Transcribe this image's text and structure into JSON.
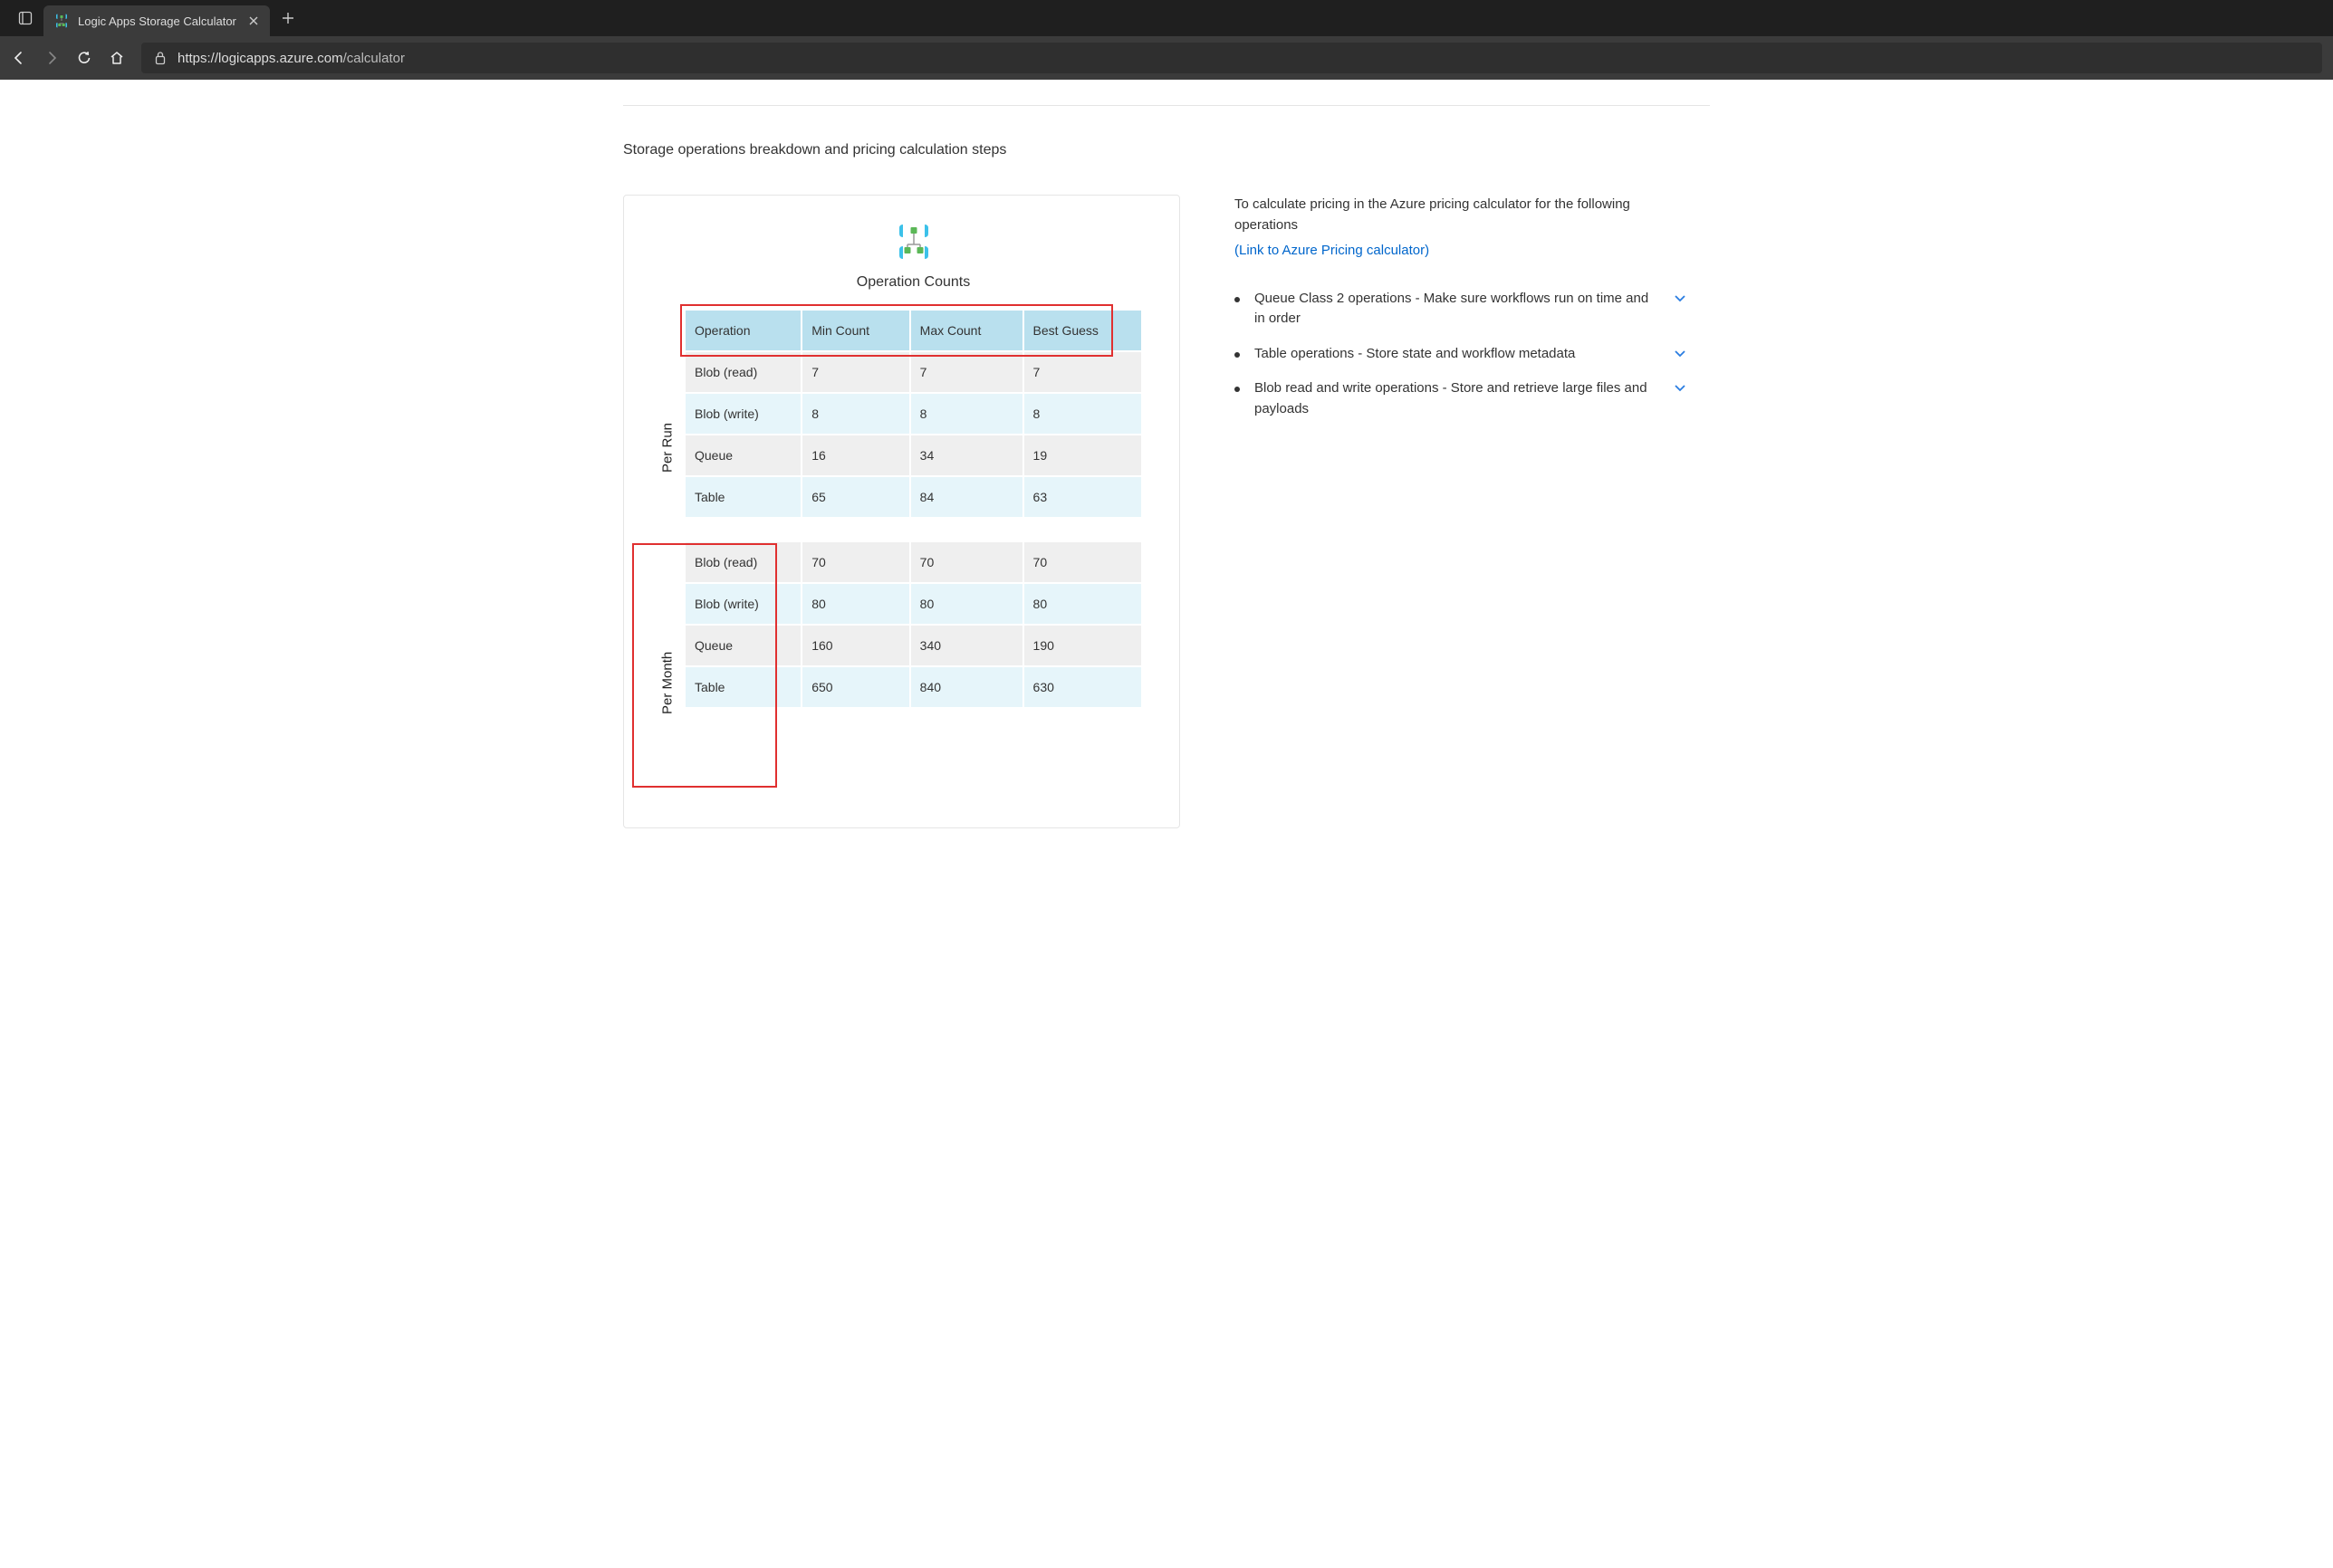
{
  "browser": {
    "tab_title": "Logic Apps Storage Calculator",
    "url_host": "https://logicapps.azure.com",
    "url_path": "/calculator"
  },
  "page": {
    "breakdown_heading": "Storage operations breakdown and pricing calculation steps",
    "panel": {
      "title": "Operation Counts",
      "side_labels": {
        "per_run": "Per Run",
        "per_month": "Per Month"
      },
      "headers": {
        "operation": "Operation",
        "min": "Min Count",
        "max": "Max Count",
        "best": "Best Guess"
      },
      "per_run_rows": [
        {
          "op": "Blob (read)",
          "min": "7",
          "max": "7",
          "best": "7"
        },
        {
          "op": "Blob (write)",
          "min": "8",
          "max": "8",
          "best": "8"
        },
        {
          "op": "Queue",
          "min": "16",
          "max": "34",
          "best": "19"
        },
        {
          "op": "Table",
          "min": "65",
          "max": "84",
          "best": "63"
        }
      ],
      "per_month_rows": [
        {
          "op": "Blob (read)",
          "min": "70",
          "max": "70",
          "best": "70"
        },
        {
          "op": "Blob (write)",
          "min": "80",
          "max": "80",
          "best": "80"
        },
        {
          "op": "Queue",
          "min": "160",
          "max": "340",
          "best": "190"
        },
        {
          "op": "Table",
          "min": "650",
          "max": "840",
          "best": "630"
        }
      ]
    },
    "sidebar": {
      "intro": "To calculate pricing in the Azure pricing calculator for the following operations",
      "link_text": "(Link to Azure Pricing calculator)",
      "items": [
        "Queue Class 2 operations - Make sure workflows run on time and in order",
        "Table operations - Store state and workflow metadata",
        "Blob read and write operations - Store and retrieve large files and payloads"
      ]
    }
  }
}
